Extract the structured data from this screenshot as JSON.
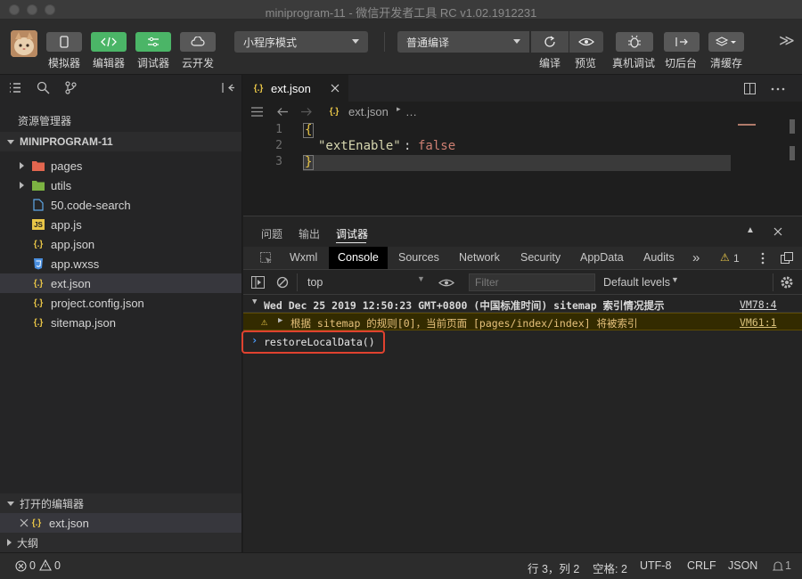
{
  "window": {
    "title": "miniprogram-11 - 微信开发者工具 RC v1.02.1912231"
  },
  "toolbar": {
    "simulator_label": "模拟器",
    "editor_label": "编辑器",
    "debugger_label": "调试器",
    "cloud_label": "云开发",
    "mode_select": "小程序模式",
    "compile_select": "普通编译",
    "compile_label": "编译",
    "preview_label": "预览",
    "realdevice_label": "真机调试",
    "background_label": "切后台",
    "clearcache_label": "清缓存",
    "more_glyph": "≫"
  },
  "sidebar": {
    "header": "资源管理器",
    "project_name": "MINIPROGRAM-11",
    "files": [
      {
        "name": "pages"
      },
      {
        "name": "utils"
      },
      {
        "name": "50.code-search"
      },
      {
        "name": "app.js"
      },
      {
        "name": "app.json"
      },
      {
        "name": "app.wxss"
      },
      {
        "name": "ext.json"
      },
      {
        "name": "project.config.json"
      },
      {
        "name": "sitemap.json"
      }
    ],
    "open_editors_title": "打开的编辑器",
    "open_editor_file": "ext.json",
    "outline_title": "大纲"
  },
  "editor": {
    "tab_name": "ext.json",
    "breadcrumb_file": "ext.json",
    "breadcrumb_more": "…",
    "lines": [
      {
        "num": "1",
        "text": "{"
      },
      {
        "num": "2",
        "key": "\"extEnable\"",
        "colon": ": ",
        "value": "false"
      },
      {
        "num": "3",
        "text": "}"
      }
    ]
  },
  "panel": {
    "tabs": [
      "问题",
      "输出",
      "调试器"
    ],
    "devtools_tabs": [
      "Wxml",
      "Console",
      "Sources",
      "Network",
      "Security",
      "AppData",
      "Audits"
    ],
    "more_tabs": "»",
    "warning_count": "1",
    "context": "top",
    "filter_placeholder": "Filter",
    "levels": "Default levels",
    "logs": [
      {
        "text": "Wed Dec 25 2019 12:50:23 GMT+0800 (中国标准时间) sitemap 索引情况提示",
        "source": "VM78:4"
      },
      {
        "text": "根据 sitemap 的规则[0]，当前页面 [pages/index/index] 将被索引",
        "source": "VM61:1"
      }
    ],
    "input_command": "restoreLocalData()"
  },
  "statusbar": {
    "errors": "0",
    "warnings": "0",
    "position": "行 3，列 2",
    "spaces": "空格: 2",
    "encoding": "UTF-8",
    "eol": "CRLF",
    "language": "JSON",
    "notifications": "1"
  },
  "colors": {
    "accent_green": "#4bb567",
    "json_key": "#d7d7b0",
    "json_false": "#ce7f72",
    "highlight_box": "#e0422f",
    "warning_yellow": "#e7c547"
  }
}
